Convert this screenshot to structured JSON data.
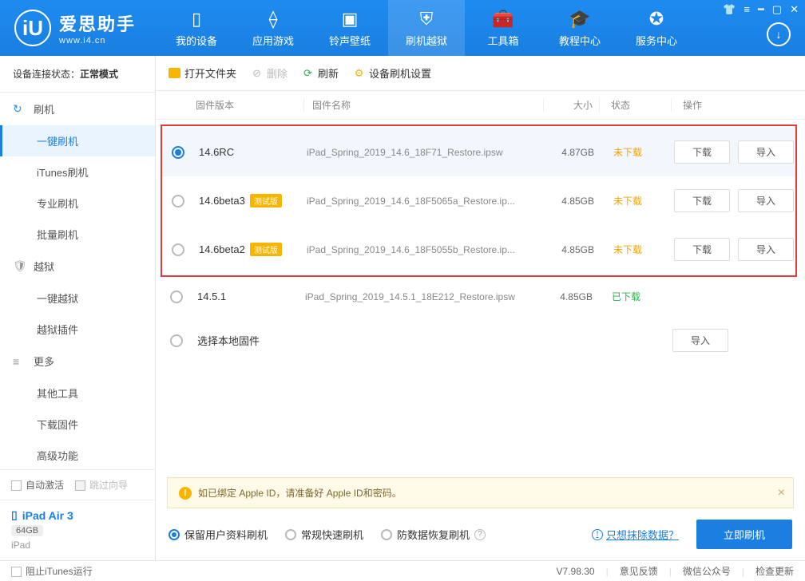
{
  "app": {
    "title": "爱思助手",
    "subtitle": "www.i4.cn"
  },
  "nav": {
    "items": [
      {
        "label": "我的设备"
      },
      {
        "label": "应用游戏"
      },
      {
        "label": "铃声壁纸"
      },
      {
        "label": "刷机越狱"
      },
      {
        "label": "工具箱"
      },
      {
        "label": "教程中心"
      },
      {
        "label": "服务中心"
      }
    ]
  },
  "sidebar": {
    "conn_label": "设备连接状态：",
    "conn_value": "正常模式",
    "groups": {
      "flash": "刷机",
      "flash_items": [
        "一键刷机",
        "iTunes刷机",
        "专业刷机",
        "批量刷机"
      ],
      "jailbreak": "越狱",
      "jailbreak_items": [
        "一键越狱",
        "越狱插件"
      ],
      "more": "更多",
      "more_items": [
        "其他工具",
        "下载固件",
        "高级功能"
      ]
    },
    "auto_activate": "自动激活",
    "skip_guide": "跳过向导",
    "device": {
      "name": "iPad Air 3",
      "capacity": "64GB",
      "type": "iPad"
    }
  },
  "toolbar": {
    "open_folder": "打开文件夹",
    "delete": "删除",
    "refresh": "刷新",
    "settings": "设备刷机设置"
  },
  "columns": {
    "version": "固件版本",
    "name": "固件名称",
    "size": "大小",
    "status": "状态",
    "op": "操作"
  },
  "rows": [
    {
      "version": "14.6RC",
      "beta": false,
      "name": "iPad_Spring_2019_14.6_18F71_Restore.ipsw",
      "size": "4.87GB",
      "status": "未下载",
      "status_cls": "not",
      "dl": true,
      "imp": true,
      "sel": true
    },
    {
      "version": "14.6beta3",
      "beta": true,
      "name": "iPad_Spring_2019_14.6_18F5065a_Restore.ip...",
      "size": "4.85GB",
      "status": "未下载",
      "status_cls": "not",
      "dl": true,
      "imp": true,
      "sel": false
    },
    {
      "version": "14.6beta2",
      "beta": true,
      "name": "iPad_Spring_2019_14.6_18F5055b_Restore.ip...",
      "size": "4.85GB",
      "status": "未下载",
      "status_cls": "not",
      "dl": true,
      "imp": true,
      "sel": false
    },
    {
      "version": "14.5.1",
      "beta": false,
      "name": "iPad_Spring_2019_14.5.1_18E212_Restore.ipsw",
      "size": "4.85GB",
      "status": "已下载",
      "status_cls": "done",
      "dl": false,
      "imp": false,
      "sel": false
    }
  ],
  "beta_badge": "测试版",
  "local_firmware": "选择本地固件",
  "btn_download": "下载",
  "btn_import": "导入",
  "notice": "如已绑定 Apple ID，请准备好 Apple ID和密码。",
  "modes": {
    "keep": "保留用户资料刷机",
    "normal": "常规快速刷机",
    "anti": "防数据恢复刷机"
  },
  "erase_link": "只想抹除数据？",
  "flash_now": "立即刷机",
  "statusbar": {
    "block_itunes": "阻止iTunes运行",
    "version": "V7.98.30",
    "feedback": "意见反馈",
    "wechat": "微信公众号",
    "update": "检查更新"
  }
}
